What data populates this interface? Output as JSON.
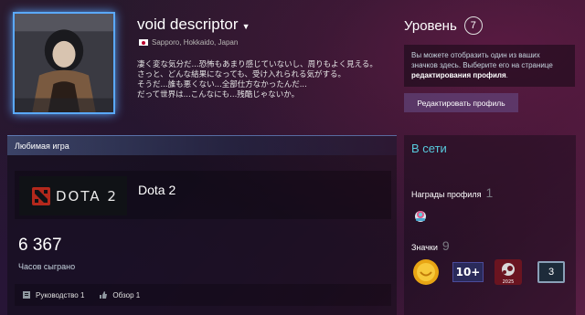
{
  "profile": {
    "persona_name": "void descriptor",
    "location": "Sapporo, Hokkaido, Japan",
    "summary_lines": [
      "凄く変な気分だ...恐怖もあまり感じていないし、周りもよく見える。",
      "さっと、どんな結果になっても、受け入れられる気がする。",
      "そうだ...誰も悪くない...全部仕方なかったんだ...",
      "だって世界は...こんなにも...残酷じゃないか。"
    ]
  },
  "level": {
    "label": "Уровень",
    "value": "7",
    "info_text": "Вы можете отобразить один из ваших значков здесь. Выберите его на странице ",
    "info_link": "редактирования профиля",
    "info_end": ".",
    "edit_button": "Редактировать профиль"
  },
  "favorite_game": {
    "header": "Любимая игра",
    "logo_text": "DOTA 2",
    "name": "Dota 2",
    "hours": "6 367",
    "hours_label": "Часов сыграно",
    "guides_label": "Руководство 1",
    "reviews_label": "Обзор 1"
  },
  "sidebar": {
    "status": "В сети",
    "awards_label": "Награды профиля",
    "awards_count": "1",
    "badges_label": "Значки",
    "badges_count": "9",
    "badge_years_text": "10+",
    "badge_steam_year": "2025",
    "badge_level_text": "3"
  },
  "colors": {
    "online": "#57cbde",
    "avatar_border": "#5aa9ff"
  },
  "icons": [
    "caret-down-icon",
    "japan-flag-icon",
    "dota2-logo-icon",
    "guide-icon",
    "review-thumb-icon",
    "award-icon",
    "coin-badge-icon",
    "years-badge-icon",
    "steam-badge-icon",
    "level-badge-icon"
  ]
}
